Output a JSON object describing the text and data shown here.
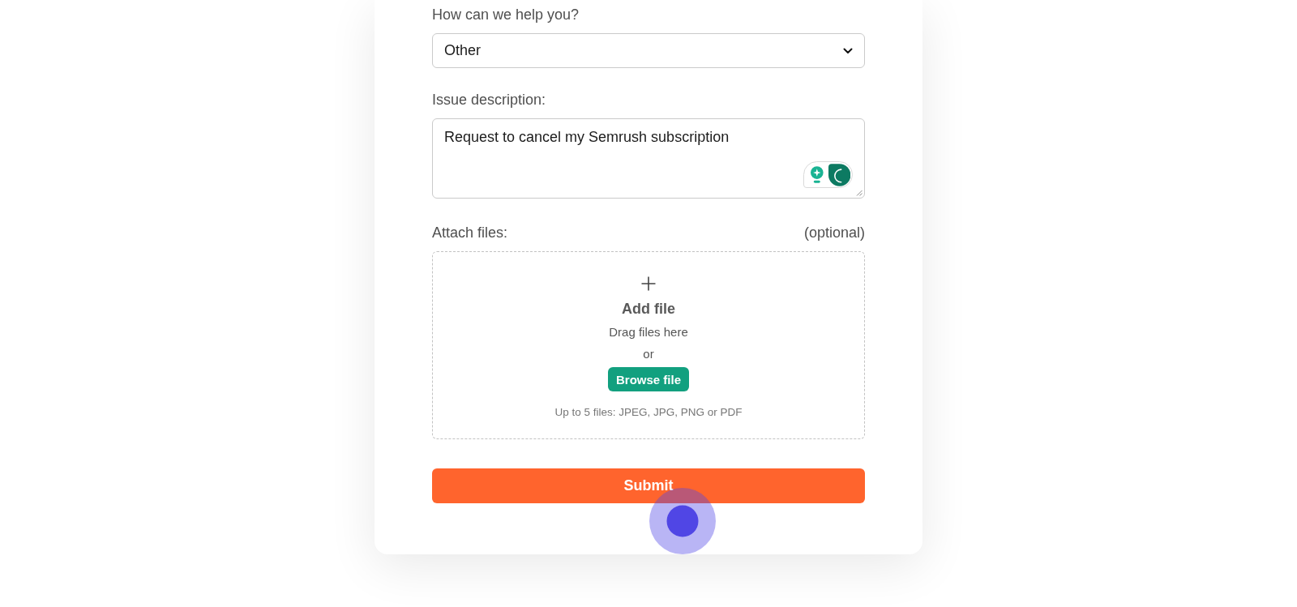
{
  "form": {
    "fields": [
      {
        "kind": "select",
        "label": "How can we help you?",
        "value": "Other"
      },
      {
        "kind": "textarea",
        "label": "Issue description:",
        "value": "Request to cancel my Semrush subscription"
      },
      {
        "kind": "upload",
        "label": "Attach files:",
        "note": "(optional)",
        "title": "Add file",
        "hint": "Drag files here",
        "separator": "or",
        "button": "Browse file",
        "limits": "Up to 5 files: JPEG, JPG, PNG or PDF"
      }
    ],
    "submit_button": "Submit"
  }
}
